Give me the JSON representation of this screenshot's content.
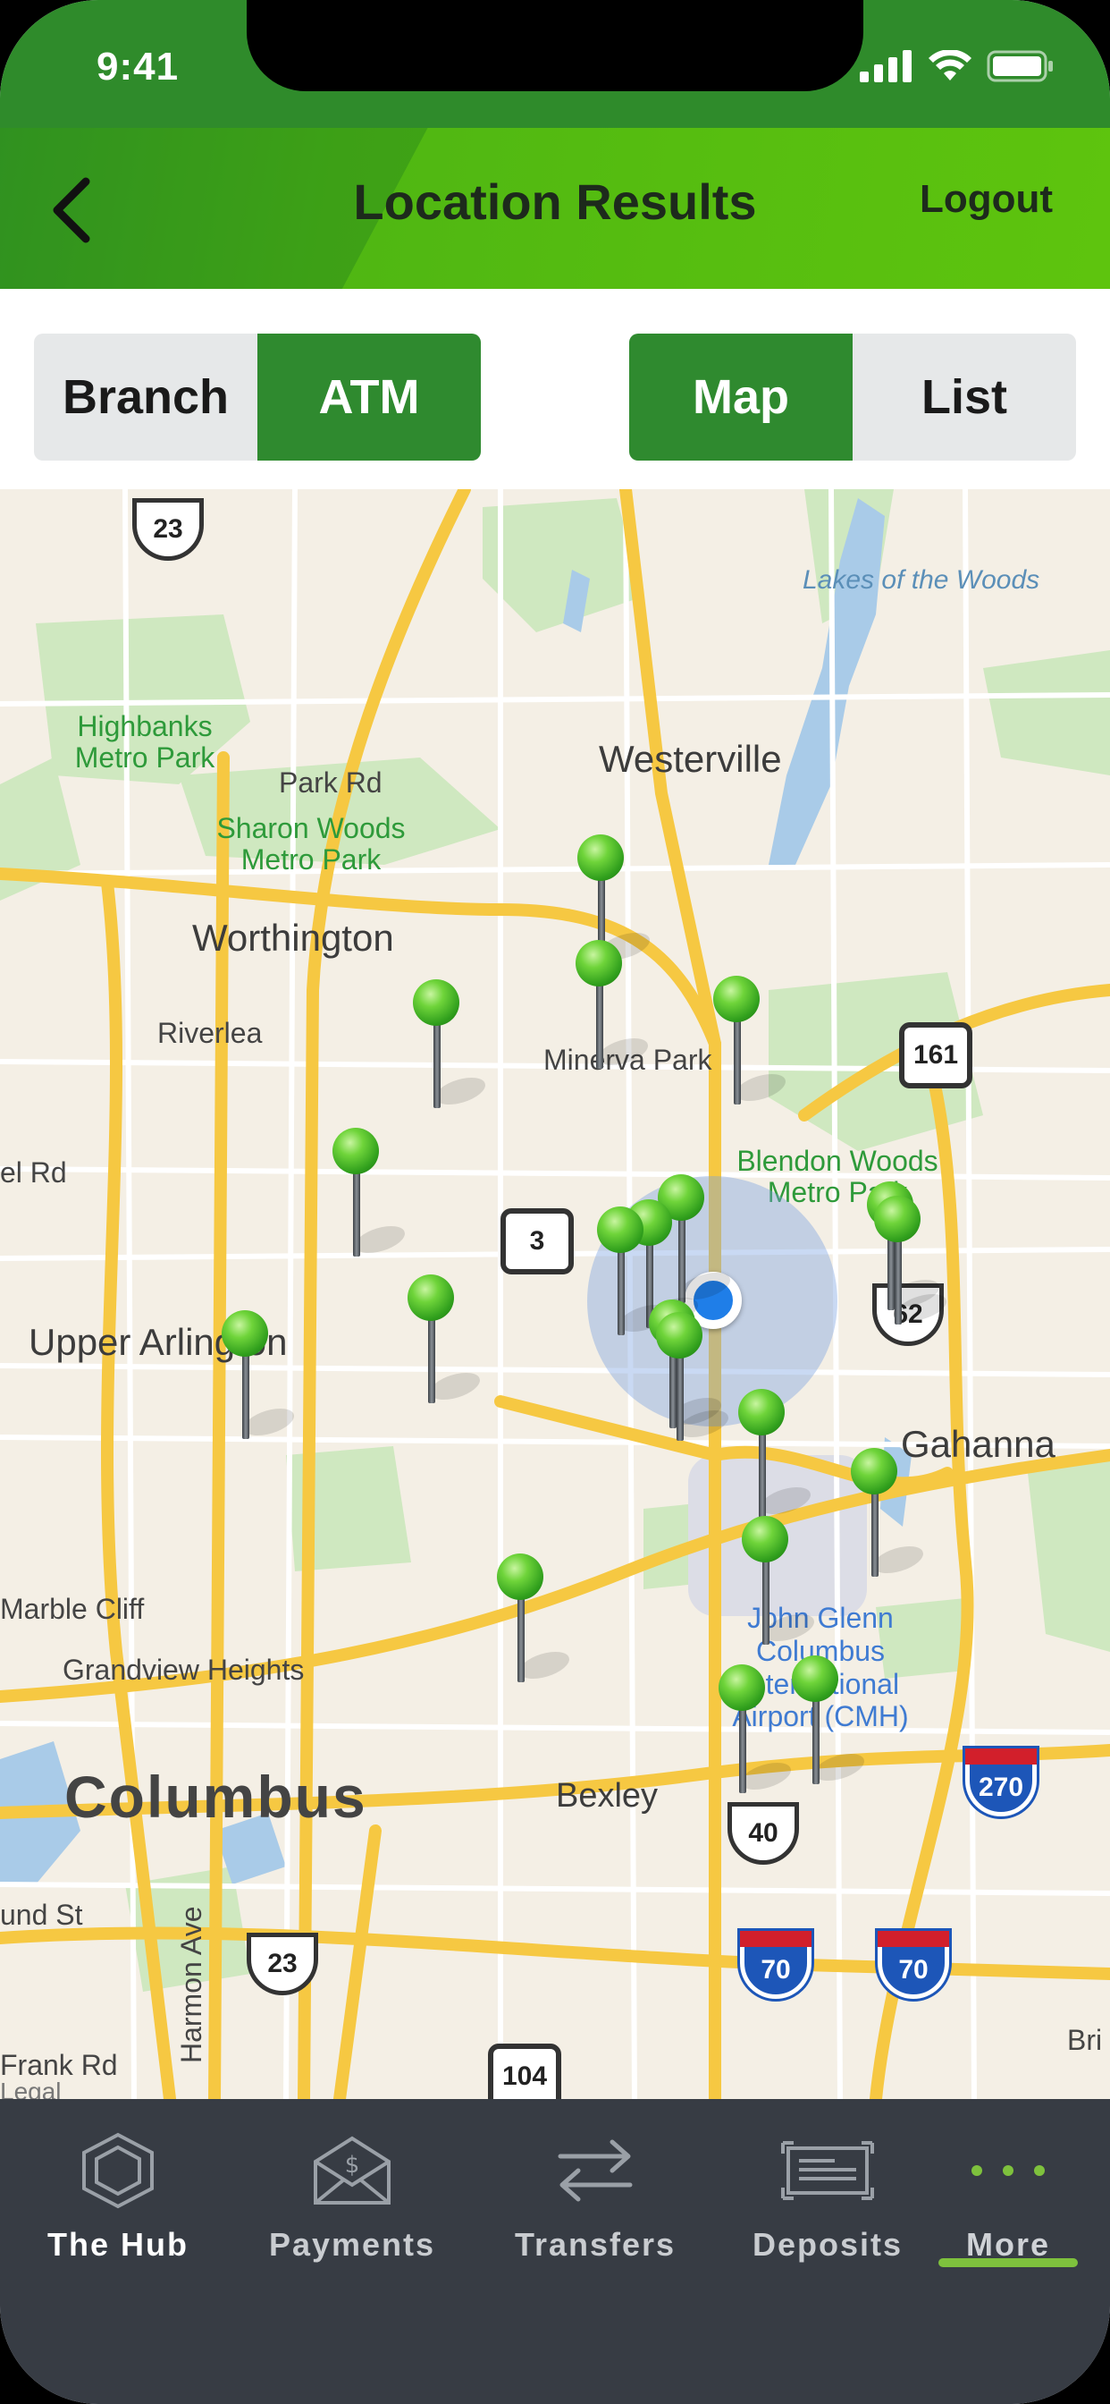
{
  "status_bar": {
    "time": "9:41"
  },
  "header": {
    "title": "Location Results",
    "logout_label": "Logout"
  },
  "location_type": {
    "options": [
      "Branch",
      "ATM"
    ],
    "selected": "ATM"
  },
  "view_mode": {
    "options": [
      "Map",
      "List"
    ],
    "selected": "Map"
  },
  "map": {
    "labels": {
      "lakes_of_the_woods": "Lakes of the Woods",
      "highbanks": "Highbanks Metro Park",
      "park_rd": "Park Rd",
      "westerville": "Westerville",
      "sharon_woods": "Sharon Woods Metro Park",
      "worthington": "Worthington",
      "riverlea": "Riverlea",
      "minerva_park": "Minerva Park",
      "el_rd": "el Rd",
      "blendon_woods": "Blendon Woods Metro Park",
      "upper_arlington": "Upper Arlington",
      "gahanna": "Gahanna",
      "marble_cliff": "Marble Cliff",
      "grandview_heights": "Grandview Heights",
      "john_glenn": "John Glenn Columbus International Airport (CMH)",
      "columbus": "Columbus",
      "bexley": "Bexley",
      "und_st": "und St",
      "harmon_ave": "Harmon Ave",
      "frank_rd": "Frank Rd",
      "legal": "Legal",
      "bri": "Bri"
    },
    "shields": {
      "us23_top": "23",
      "oh161": "161",
      "oh3": "3",
      "us62": "62",
      "i270": "270",
      "us40": "40",
      "us23_bottom": "23",
      "i70_left": "70",
      "i70_right": "70",
      "oh104": "104"
    }
  },
  "tab_bar": {
    "tabs": [
      {
        "label": "The Hub",
        "icon": "hexagon-icon"
      },
      {
        "label": "Payments",
        "icon": "payment-envelope-icon"
      },
      {
        "label": "Transfers",
        "icon": "transfer-arrows-icon"
      },
      {
        "label": "Deposits",
        "icon": "deposit-check-icon"
      },
      {
        "label": "More",
        "icon": "more-dots-icon"
      }
    ],
    "active": "More"
  },
  "colors": {
    "header_green": "#56bd10",
    "selected_segment": "#2f8a2f",
    "tab_bar_bg": "#373c44",
    "active_indicator": "#7ec13d"
  }
}
